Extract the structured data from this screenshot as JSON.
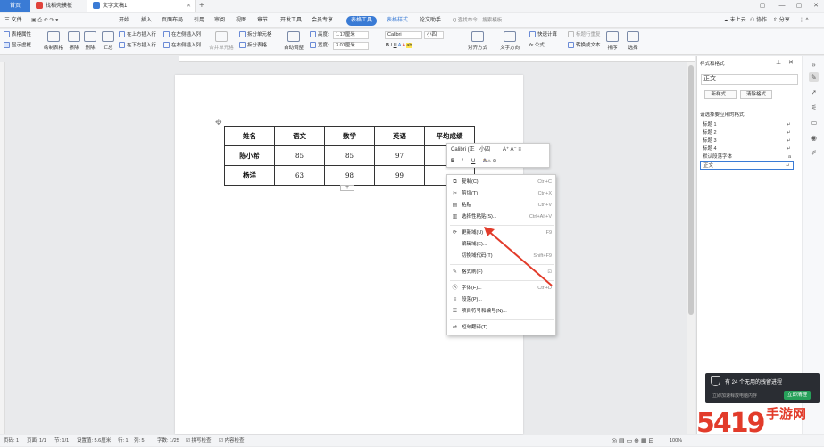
{
  "titlebar": {
    "tab_home": "首页",
    "tab_template": "找稻壳模板",
    "tab_doc": "文字文稿1",
    "new_tab": "+",
    "win_controls": [
      "▢",
      "—",
      "▢",
      "✕"
    ]
  },
  "menubar": {
    "file": "三 文件",
    "items": [
      "开始",
      "插入",
      "页面布局",
      "引用",
      "审阅",
      "视图",
      "章节",
      "开发工具",
      "会员专享"
    ],
    "active_tab": "表格工具",
    "extra_tabs": [
      "表格样式",
      "论文助手"
    ],
    "search_placeholder": "Q 查找命令、搜索模板",
    "cloud": "未上云",
    "collab": "协作",
    "share": "分享"
  },
  "ribbon": {
    "props": "表格属性",
    "show_grid": "显示虚框",
    "draw_table": "绘制表格",
    "erase": "擦除",
    "delete": "删除",
    "summary": "汇总",
    "insert_above": "在上方插入行",
    "insert_below": "在下方插入行",
    "insert_left": "在左侧插入列",
    "insert_right": "在右侧插入列",
    "merge": "合并单元格",
    "split_cell": "拆分单元格",
    "split_table": "拆分表格",
    "autofit": "自动调整",
    "height_label": "高度:",
    "height_value": "1.17厘米",
    "width_label": "宽度:",
    "width_value": "3.01厘米",
    "font": "Calibri",
    "size": "小四",
    "align": "对齐方式",
    "direction": "文字方向",
    "quick_calc": "快速计算",
    "title_repeat": "标题行重复",
    "formula": "公式",
    "convert": "转换成文本",
    "sort": "排序",
    "select": "选择"
  },
  "table": {
    "header": [
      "姓名",
      "语文",
      "数学",
      "英语",
      "平均成绩"
    ],
    "rows": [
      [
        "陈小希",
        "85",
        "85",
        "97",
        "8"
      ],
      [
        "杨洋",
        "63",
        "98",
        "99",
        ""
      ]
    ]
  },
  "mini_toolbar": {
    "font": "Calibri (正",
    "size": "小四",
    "bold": "B",
    "italic": "I",
    "underline": "U"
  },
  "context_menu": {
    "items": [
      {
        "label": "复制(C)",
        "shortcut": "Ctrl+C",
        "icon": "copy-icon"
      },
      {
        "label": "剪切(T)",
        "shortcut": "Ctrl+X",
        "icon": "cut-icon"
      },
      {
        "label": "粘贴",
        "shortcut": "Ctrl+V",
        "icon": "paste-icon"
      },
      {
        "label": "选择性粘贴(S)...",
        "shortcut": "Ctrl+Alt+V",
        "icon": "paste-special-icon"
      },
      {
        "label": "更新域(U)",
        "shortcut": "F9",
        "icon": "update-field-icon"
      },
      {
        "label": "编辑域(E)...",
        "shortcut": "",
        "icon": ""
      },
      {
        "label": "切换域代码(T)",
        "shortcut": "Shift+F9",
        "icon": ""
      },
      {
        "label": "格式刷(F)",
        "shortcut": "",
        "icon": "format-painter-icon"
      },
      {
        "label": "字体(F)...",
        "shortcut": "Ctrl+D",
        "icon": "font-icon"
      },
      {
        "label": "段落(P)...",
        "shortcut": "",
        "icon": "paragraph-icon"
      },
      {
        "label": "项目符号和编号(N)...",
        "shortcut": "",
        "icon": "bullets-icon"
      },
      {
        "label": "短句翻译(T)",
        "shortcut": "",
        "icon": "translate-icon"
      }
    ]
  },
  "sidebar": {
    "title": "样式和格式",
    "current_style": "正文",
    "new_style": "新样式...",
    "clear_format": "清除格式",
    "apply_label": "请选择要应用的格式",
    "styles": [
      "标题 1",
      "标题 2",
      "标题 3",
      "标题 4",
      "默认段落字体",
      "正文"
    ]
  },
  "toast": {
    "message": "有 24 个无用的残留进程",
    "sub": "立即加速释放电脑内存",
    "button": "立即清理"
  },
  "statusbar": {
    "page": "页码: 1",
    "pages": "页面: 1/1",
    "section": "节: 1/1",
    "setting": "设置值: 5.6厘米",
    "row": "行: 1",
    "col": "列: 5",
    "words": "字数: 1/25",
    "spell": "拼写检查",
    "content_check": "内容检查",
    "zoom": "100%"
  },
  "watermark": {
    "digits": "5419",
    "text": "手游网"
  }
}
